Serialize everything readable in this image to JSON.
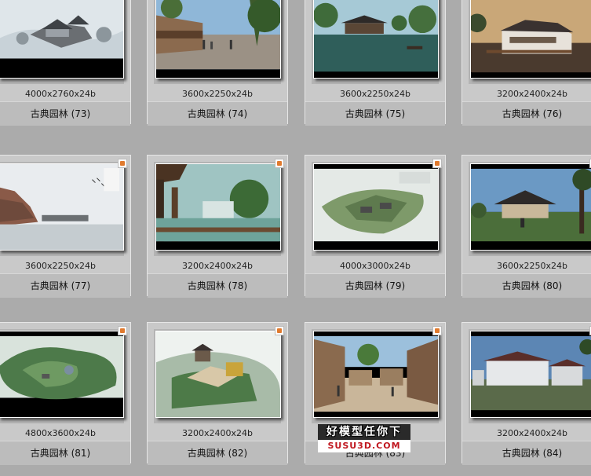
{
  "thumbnails": [
    {
      "dims": "4000x2760x24b",
      "name": "古典园林 (73)",
      "scene": "snow-village"
    },
    {
      "dims": "3600x2250x24b",
      "name": "古典园林 (74)",
      "scene": "street"
    },
    {
      "dims": "3600x2250x24b",
      "name": "古典园林 (75)",
      "scene": "lake-pavilion"
    },
    {
      "dims": "3200x2400x24b",
      "name": "古典园林 (76)",
      "scene": "dusk-village"
    },
    {
      "dims": "3600x2250x24b",
      "name": "古典园林 (77)",
      "scene": "misty-cliff"
    },
    {
      "dims": "3200x2400x24b",
      "name": "古典园林 (78)",
      "scene": "waterfall"
    },
    {
      "dims": "4000x3000x24b",
      "name": "古典园林 (79)",
      "scene": "aerial-plan"
    },
    {
      "dims": "3600x2250x24b",
      "name": "古典园林 (80)",
      "scene": "temple"
    },
    {
      "dims": "4800x3600x24b",
      "name": "古典园林 (81)",
      "scene": "aerial-green"
    },
    {
      "dims": "3200x2400x24b",
      "name": "古典园林 (82)",
      "scene": "aerial-temple"
    },
    {
      "dims": "",
      "name": "古典园林 (83)",
      "scene": "town-street"
    },
    {
      "dims": "3200x2400x24b",
      "name": "古典园林 (84)",
      "scene": "hotel"
    }
  ],
  "watermark": {
    "line1": "好模型任你下",
    "line2": "SUSU3D.COM"
  }
}
